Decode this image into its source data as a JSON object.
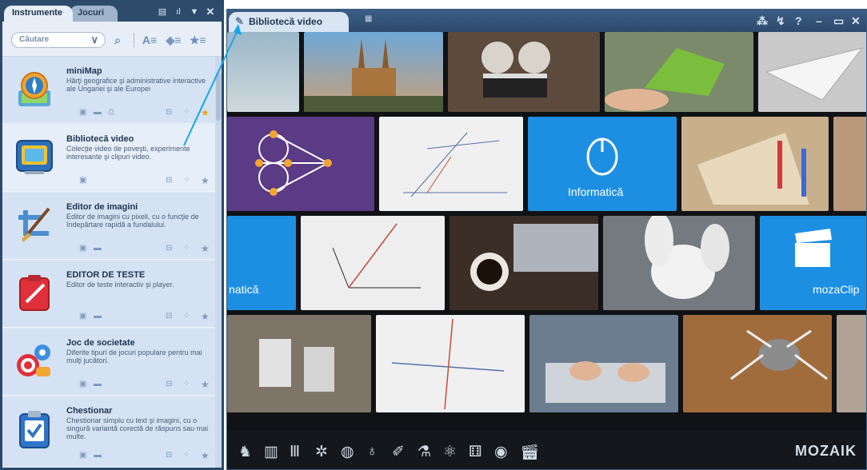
{
  "left_panel": {
    "tabs": [
      "Instrumente",
      "Jocuri"
    ],
    "search_placeholder": "Căutare",
    "items": [
      {
        "title": "miniMap",
        "desc": "Hărţi geografice şi administrative interactive ale Ungariei şi ale Europei"
      },
      {
        "title": "Bibliotecă video",
        "desc": "Colecţie video de poveşti, experimente interesante şi clipuri video."
      },
      {
        "title": "Editor de imagini",
        "desc": "Editor de imagini cu pixeli, cu o funcţie de îndepărtare rapidă a fundalului."
      },
      {
        "title": "EDITOR DE TESTE",
        "desc": "Editor de teste interactiv şi player."
      },
      {
        "title": "Joc de societate",
        "desc": "Diferite tipuri de jocuri populare pentru mai mulţi jucători."
      },
      {
        "title": "Chestionar",
        "desc": "Chestionar simplu cu text şi imagini, cu o singură variantă corectă de răspuns sau mai multe."
      }
    ]
  },
  "main": {
    "tab_title": "Bibliotecă video",
    "tiles": {
      "informatica": "Informatică",
      "informatica_partial": "natică",
      "mozaclip": "mozaClip"
    },
    "logo": "MOZAIK"
  },
  "colors": {
    "purple": "#5b3a86",
    "blue_tile": "#1d8fe3",
    "frame": "#2b4a6b",
    "annotation": "#15a6e8",
    "star": "#f0a313"
  }
}
